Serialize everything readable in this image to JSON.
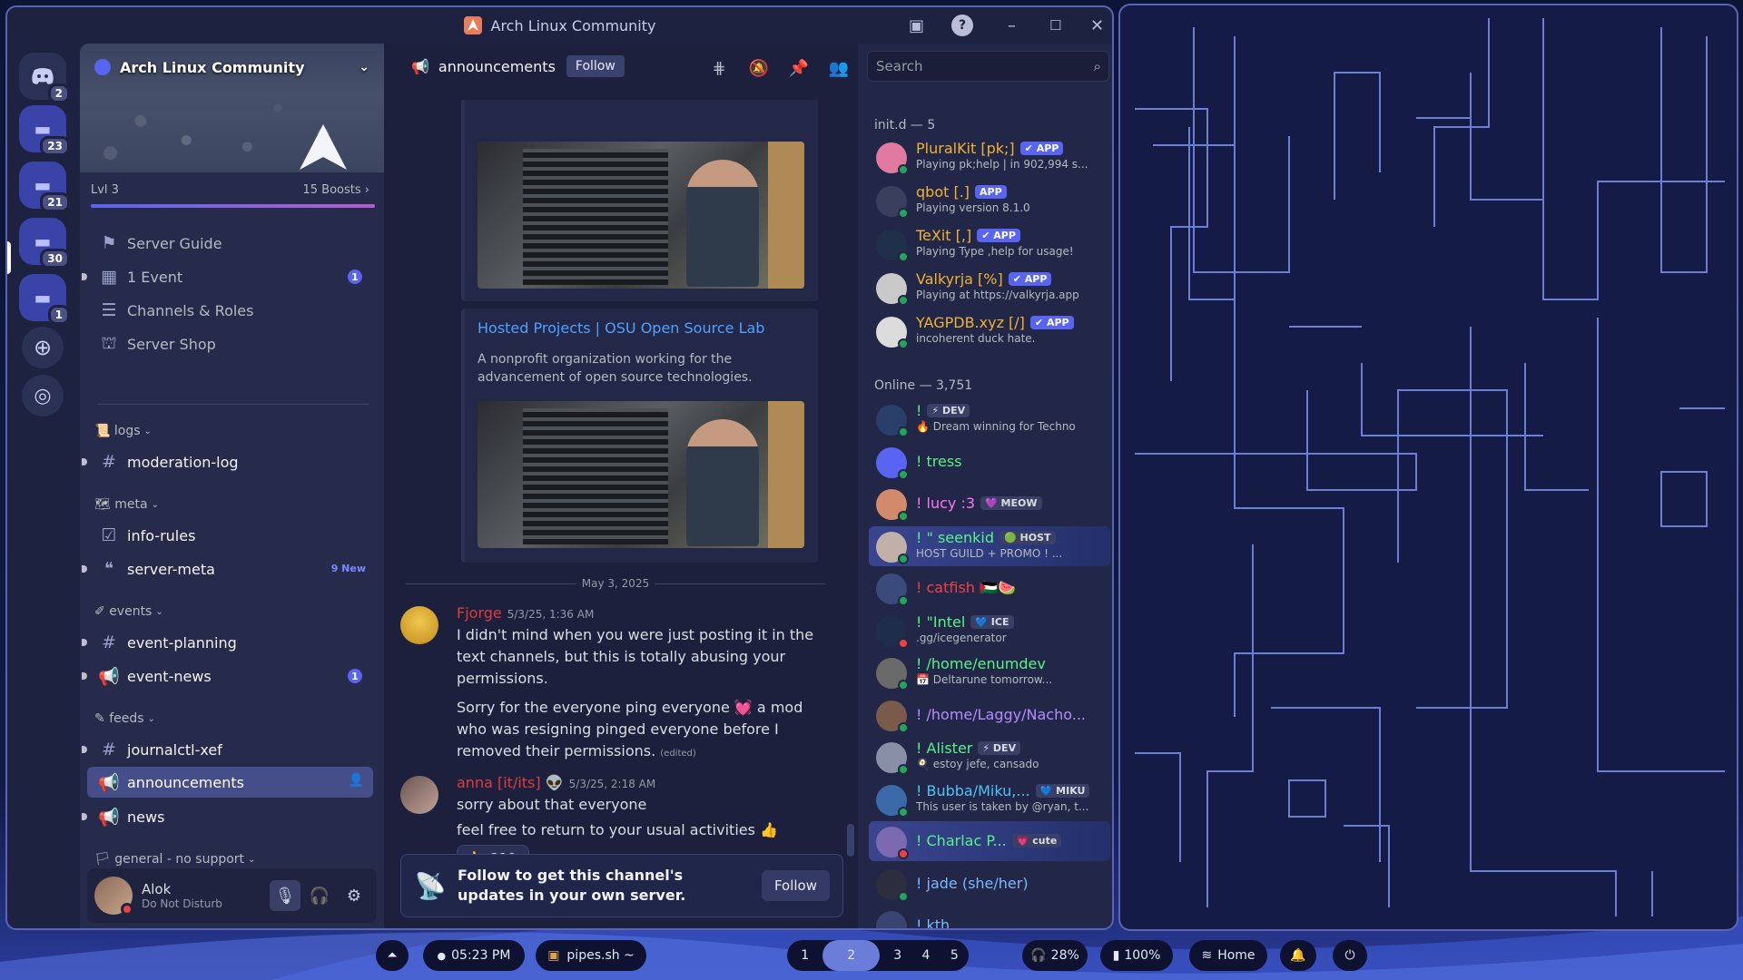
{
  "window": {
    "title": "Arch Linux Community"
  },
  "guilds": {
    "home_badge": "2",
    "folders": [
      {
        "badge": "23"
      },
      {
        "badge": "21"
      },
      {
        "badge": "30"
      },
      {
        "badge": "1"
      }
    ]
  },
  "server": {
    "name": "Arch Linux Community",
    "level": "Lvl 3",
    "boosts": "15 Boosts",
    "boost_progress": 0.99
  },
  "sidebar": {
    "items": [
      {
        "label": "Server Guide"
      },
      {
        "label": "1 Event",
        "count": "1"
      },
      {
        "label": "Channels & Roles"
      },
      {
        "label": "Server Shop"
      }
    ],
    "categories": {
      "logs": "logs",
      "meta": "meta",
      "events": "events",
      "feeds": "feeds",
      "general": "general - no support"
    },
    "channels": {
      "moderation_log": "moderation-log",
      "info_rules": "info-rules",
      "server_meta": "server-meta",
      "server_meta_new": "9 New",
      "event_planning": "event-planning",
      "event_news": "event-news",
      "event_news_count": "1",
      "journalctl": "journalctl-xef",
      "announcements": "announcements",
      "news": "news"
    }
  },
  "user": {
    "name": "Alok",
    "status": "Do Not Disturb"
  },
  "chat": {
    "channel": "announcements",
    "follow_label": "Follow",
    "embed": {
      "title": "Hosted Projects | OSU Open Source Lab",
      "description": "A nonprofit organization working for the advancement of open source technologies."
    },
    "date_separator": "May 3, 2025",
    "messages": [
      {
        "author": "Fjorge",
        "time": "5/3/25, 1:36 AM",
        "lines": [
          "I didn't mind when you were just posting it in the text channels, but this is totally abusing your permissions.",
          "Sorry for the everyone ping everyone 💓 a mod who was resigning pinged everyone before I removed their permissions."
        ],
        "edited": "(edited)"
      },
      {
        "author": "anna [it/its]",
        "author_badge": "👽",
        "time": "5/3/25, 2:18 AM",
        "lines": [
          "sorry about that everyone",
          "feel free to return to your usual activities 👍"
        ],
        "reaction": {
          "emoji": "👍",
          "count": "219"
        }
      }
    ],
    "follow_bar": {
      "text": "Follow to get this channel's updates in your own server.",
      "button": "Follow"
    }
  },
  "members": {
    "search_placeholder": "Search",
    "group1": "init.d — 5",
    "group2": "Online — 3,751",
    "bots": [
      {
        "name": "PluralKit [pk;]",
        "tag": "✔ APP",
        "status": "Playing pk;help | in 902,994 s..."
      },
      {
        "name": "qbot [.]",
        "tag": "APP",
        "status": "Playing version 8.1.0"
      },
      {
        "name": "TeXit [,]",
        "tag": "✔ APP",
        "status": "Playing Type ,help for usage!"
      },
      {
        "name": "Valkyrja [%]",
        "tag": "✔ APP",
        "status": "Playing at https://valkyrja.app"
      },
      {
        "name": "YAGPDB.xyz [/]",
        "tag": "✔ APP",
        "status": "incoherent duck hate."
      }
    ],
    "online": [
      {
        "name": "!",
        "tag": "⚡ DEV",
        "status": "🔥 Dream winning for Techno",
        "color": "#57f287"
      },
      {
        "name": "! tress",
        "tag": "",
        "status": "",
        "color": "#57f287"
      },
      {
        "name": "! lucy :3",
        "tag": "💜 MEOW",
        "status": "",
        "color": "#ff73fa"
      },
      {
        "name": "! \" seenkid",
        "tag": "🟢 HOST",
        "status": "HOST GUILD + PROMO ! ...",
        "color": "#57f287"
      },
      {
        "name": "! catfish 🇵🇸🍉",
        "tag": "",
        "status": "",
        "color": "#f23f43"
      },
      {
        "name": "! \"Intel",
        "tag": "💙 ICE",
        "status": ".gg/icegenerator",
        "color": "#57f287"
      },
      {
        "name": "! /home/enumdev",
        "tag": "",
        "status": "📅 Deltarune tomorrow...",
        "color": "#57f287"
      },
      {
        "name": "! /home/Laggy/Nacho...",
        "tag": "",
        "status": "",
        "color": "#b48cff"
      },
      {
        "name": "! Alister",
        "tag": "⚡ DEV",
        "status": "🍳 estoy jefe, cansado",
        "color": "#57f287"
      },
      {
        "name": "! Bubba/Miku,...",
        "tag": "💙 MIKU",
        "status": "This user is taken by @ryan, t...",
        "color": "#4fc3f7"
      },
      {
        "name": "! Charlac P...",
        "tag": "💗 cute",
        "status": "",
        "color": "#57f287"
      },
      {
        "name": "! jade (she/her)",
        "tag": "",
        "status": "",
        "color": "#7ab8ff"
      },
      {
        "name": "! kth",
        "tag": "",
        "status": "",
        "color": "#7ab8ff"
      }
    ]
  },
  "taskbar": {
    "time": "05:23 PM",
    "app": "pipes.sh ~",
    "workspaces": [
      "1",
      "2",
      "3",
      "4",
      "5"
    ],
    "active_workspace": "2",
    "volume": "28%",
    "battery": "100%",
    "network": "Home"
  },
  "colors": {
    "accent": "#5865f2",
    "dnd": "#f23f43",
    "online": "#23a55a",
    "link": "#4ea1ff"
  }
}
